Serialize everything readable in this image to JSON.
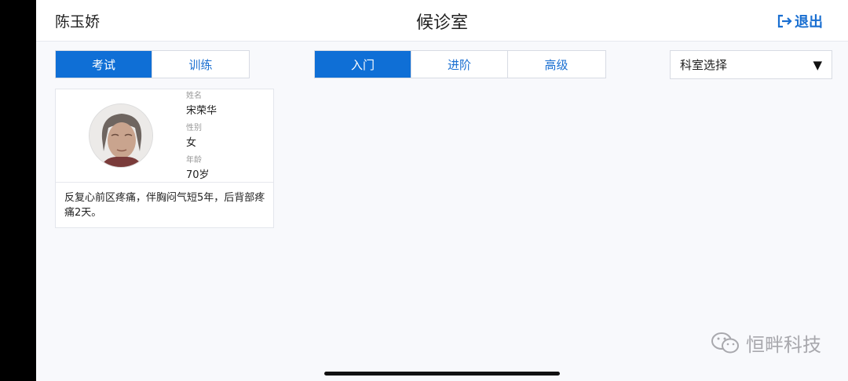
{
  "header": {
    "user_name": "陈玉娇",
    "title": "候诊室",
    "logout_label": "退出"
  },
  "mode_tabs": [
    {
      "label": "考试",
      "active": true
    },
    {
      "label": "训练",
      "active": false
    }
  ],
  "level_tabs": [
    {
      "label": "入门",
      "active": true
    },
    {
      "label": "进阶",
      "active": false
    },
    {
      "label": "高级",
      "active": false
    }
  ],
  "department_select": {
    "label": "科室选择",
    "arrow": "▼"
  },
  "patient": {
    "name_label": "姓名",
    "name": "宋荣华",
    "gender_label": "性别",
    "gender": "女",
    "age_label": "年龄",
    "age": "70岁",
    "complaint": "反复心前区疼痛，伴胸闷气短5年，后背部疼痛2天。"
  },
  "watermark": {
    "text": "恒畔科技"
  },
  "colors": {
    "accent": "#0f6fd6",
    "link": "#1a6fd1",
    "background": "#f8f9fc"
  }
}
